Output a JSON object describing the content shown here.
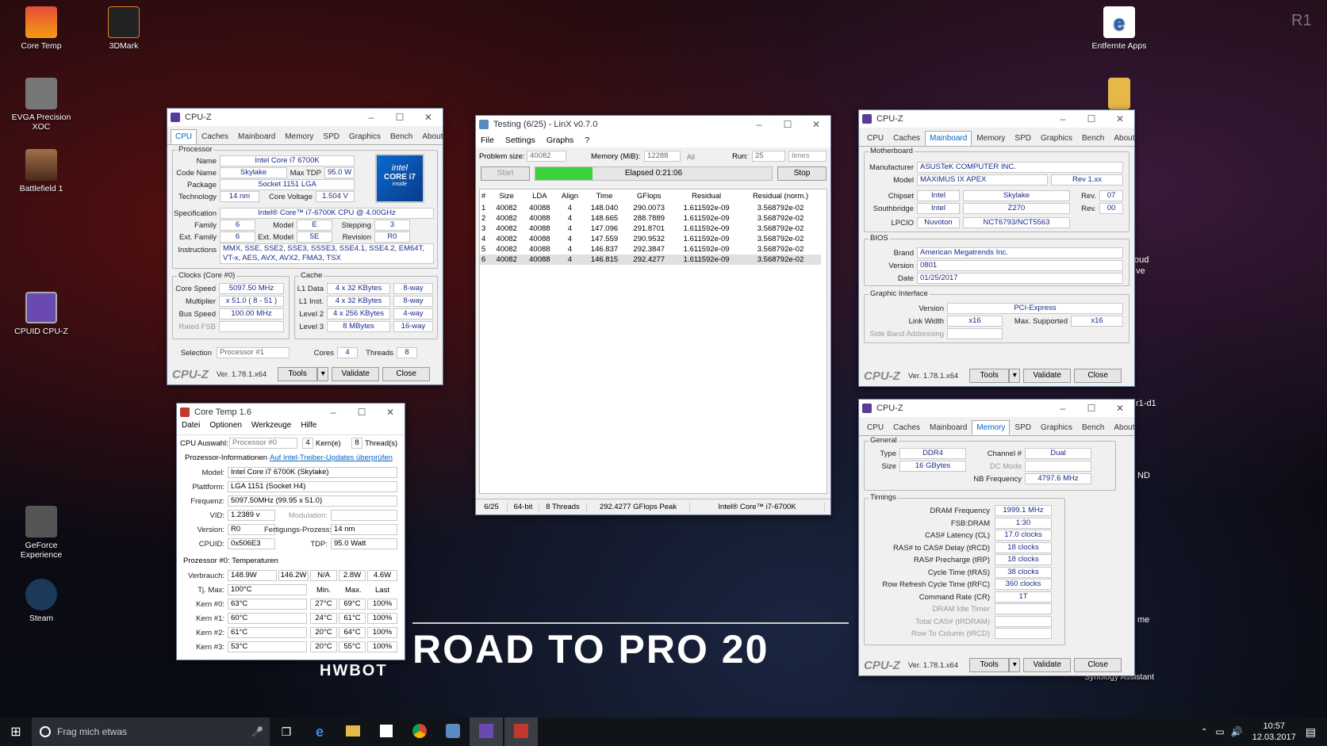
{
  "desktop": {
    "icons": [
      {
        "label": "Core Temp",
        "color": "#c0392b"
      },
      {
        "label": "3DMark",
        "color": "#333"
      },
      {
        "label": "EVGA Precision XOC",
        "color": "#555"
      },
      {
        "label": "Battlefield 1",
        "color": "#8a5a2a"
      },
      {
        "label": "CPUID CPU-Z",
        "color": "#5a3a9a"
      },
      {
        "label": "GeForce Experience",
        "color": "#444"
      },
      {
        "label": "Steam",
        "color": "#1b3a5a"
      },
      {
        "label": "Entfernte Apps",
        "color": "#1a6ac9"
      },
      {
        "label": "Synology Assistant",
        "color": "#3a6aaa"
      }
    ],
    "bg_text": {
      "road": "ROAD TO PRO 20",
      "hwbot": "HWBOT",
      "r1": "R1",
      "oud": "oud",
      "ve": "ve",
      "r1d1": "r1-d1",
      "nd": "ND",
      "me": "me"
    }
  },
  "cpuz_cpu": {
    "title": "CPU-Z",
    "tabs": [
      "CPU",
      "Caches",
      "Mainboard",
      "Memory",
      "SPD",
      "Graphics",
      "Bench",
      "About"
    ],
    "processor_label": "Processor",
    "name_l": "Name",
    "name": "Intel Core i7 6700K",
    "codename_l": "Code Name",
    "codename": "Skylake",
    "maxtdp_l": "Max TDP",
    "maxtdp": "95.0 W",
    "package_l": "Package",
    "package": "Socket 1151 LGA",
    "tech_l": "Technology",
    "tech": "14 nm",
    "corev_l": "Core Voltage",
    "corev": "1.504 V",
    "spec_l": "Specification",
    "spec": "Intel® Core™ i7-6700K CPU @ 4.00GHz",
    "family_l": "Family",
    "family": "6",
    "model_l": "Model",
    "model": "E",
    "stepping_l": "Stepping",
    "stepping": "3",
    "extfam_l": "Ext. Family",
    "extfam": "6",
    "extmodel_l": "Ext. Model",
    "extmodel": "5E",
    "revision_l": "Revision",
    "revision": "R0",
    "instr_l": "Instructions",
    "instr": "MMX, SSE, SSE2, SSE3, SSSE3, SSE4.1, SSE4.2, EM64T, VT-x, AES, AVX, AVX2, FMA3, TSX",
    "clocks_label": "Clocks (Core #0)",
    "corespeed_l": "Core Speed",
    "corespeed": "5097.50 MHz",
    "mult_l": "Multiplier",
    "mult": "x 51.0 ( 8 - 51 )",
    "bus_l": "Bus Speed",
    "bus": "100.00 MHz",
    "fsb_l": "Rated FSB",
    "cache_label": "Cache",
    "l1d_l": "L1 Data",
    "l1d": "4 x 32 KBytes",
    "l1d_w": "8-way",
    "l1i_l": "L1 Inst.",
    "l1i": "4 x 32 KBytes",
    "l1i_w": "8-way",
    "l2_l": "Level 2",
    "l2": "4 x 256 KBytes",
    "l2_w": "4-way",
    "l3_l": "Level 3",
    "l3": "8 MBytes",
    "l3_w": "16-way",
    "sel_l": "Selection",
    "sel": "Processor #1",
    "cores_l": "Cores",
    "cores": "4",
    "threads_l": "Threads",
    "threads": "8",
    "logo_line1": "intel",
    "logo_line2": "CORE i7",
    "logo_line3": "inside",
    "footer": {
      "logo": "CPU-Z",
      "version": "Ver. 1.78.1.x64",
      "tools": "Tools",
      "validate": "Validate",
      "close": "Close"
    }
  },
  "coretemp": {
    "title": "Core Temp 1.6",
    "menu": [
      "Datei",
      "Optionen",
      "Werkzeuge",
      "Hilfe"
    ],
    "cpu_sel_l": "CPU Auswahl:",
    "cpu_sel": "Processor #0",
    "kerne": "4",
    "kerne_l": "Kern(e)",
    "threads": "8",
    "threads_l": "Thread(s)",
    "info_l": "Prozessor-Informationen",
    "info_link": "Auf Intel-Treiber-Updates überprüfen",
    "model_l": "Model:",
    "model": "Intel Core i7 6700K (Skylake)",
    "platform_l": "Plattform:",
    "platform": "LGA 1151 (Socket H4)",
    "freq_l": "Frequenz:",
    "freq": "5097.50MHz (99.95 x 51.0)",
    "vid_l": "VID:",
    "vid": "1.2389 v",
    "mod_l": "Modulation:",
    "ver_l": "Version:",
    "ver": "R0",
    "fp_l": "Fertigungs-Prozess:",
    "fp": "14 nm",
    "cpuid_l": "CPUID:",
    "cpuid": "0x506E3",
    "tdp_l": "TDP:",
    "tdp": "95.0 Watt",
    "temps_title": "Prozessor #0: Temperaturen",
    "power_l": "Verbrauch:",
    "power": [
      "148.9W",
      "146.2W",
      "N/A",
      "2.8W",
      "4.6W"
    ],
    "tj_l": "Tj. Max:",
    "tj": "100°C",
    "hdr": [
      "Min.",
      "Max.",
      "Last"
    ],
    "cores": [
      {
        "n": "Kern #0:",
        "t": "63°C",
        "min": "27°C",
        "max": "69°C",
        "load": "100%"
      },
      {
        "n": "Kern #1:",
        "t": "60°C",
        "min": "24°C",
        "max": "61°C",
        "load": "100%"
      },
      {
        "n": "Kern #2:",
        "t": "61°C",
        "min": "20°C",
        "max": "64°C",
        "load": "100%"
      },
      {
        "n": "Kern #3:",
        "t": "53°C",
        "min": "20°C",
        "max": "55°C",
        "load": "100%"
      }
    ]
  },
  "linx": {
    "title": "Testing (6/25) - LinX v0.7.0",
    "menu": [
      "File",
      "Settings",
      "Graphs",
      "?"
    ],
    "ps_l": "Problem size:",
    "ps": "40082",
    "mem_l": "Memory (MiB):",
    "mem": "12288",
    "all": "All",
    "run_l": "Run:",
    "run": "25",
    "times": "times",
    "start": "Start",
    "elapsed": "Elapsed 0:21:06",
    "progress": 0.24,
    "stop": "Stop",
    "headers": [
      "#",
      "Size",
      "LDA",
      "Align",
      "Time",
      "GFlops",
      "Residual",
      "Residual (norm.)"
    ],
    "rows": [
      [
        "1",
        "40082",
        "40088",
        "4",
        "148.040",
        "290.0073",
        "1.611592e-09",
        "3.568792e-02"
      ],
      [
        "2",
        "40082",
        "40088",
        "4",
        "148.665",
        "288.7889",
        "1.611592e-09",
        "3.568792e-02"
      ],
      [
        "3",
        "40082",
        "40088",
        "4",
        "147.096",
        "291.8701",
        "1.611592e-09",
        "3.568792e-02"
      ],
      [
        "4",
        "40082",
        "40088",
        "4",
        "147.559",
        "290.9532",
        "1.611592e-09",
        "3.568792e-02"
      ],
      [
        "5",
        "40082",
        "40088",
        "4",
        "146.837",
        "292.3847",
        "1.611592e-09",
        "3.568792e-02"
      ],
      [
        "6",
        "40082",
        "40088",
        "4",
        "146.815",
        "292.4277",
        "1.611592e-09",
        "3.568792e-02"
      ]
    ],
    "status": [
      "6/25",
      "64-bit",
      "8 Threads",
      "292.4277 GFlops Peak",
      "Intel® Core™ i7-6700K"
    ]
  },
  "cpuz_mb": {
    "title": "CPU-Z",
    "tabs": [
      "CPU",
      "Caches",
      "Mainboard",
      "Memory",
      "SPD",
      "Graphics",
      "Bench",
      "About"
    ],
    "mb_label": "Motherboard",
    "manuf_l": "Manufacturer",
    "manuf": "ASUSTeK COMPUTER INC.",
    "model_l": "Model",
    "model": "MAXIMUS IX APEX",
    "modelrev": "Rev 1.xx",
    "chipset_l": "Chipset",
    "chipset": "Intel",
    "chipset2": "Skylake",
    "rev_l": "Rev.",
    "chipset_rev": "07",
    "sb_l": "Southbridge",
    "sb": "Intel",
    "sb2": "Z270",
    "sb_rev": "00",
    "lpcio_l": "LPCIO",
    "lpcio": "Nuvoton",
    "lpcio2": "NCT6793/NCT5563",
    "bios_label": "BIOS",
    "brand_l": "Brand",
    "brand": "American Megatrends Inc.",
    "bver_l": "Version",
    "bver": "0801",
    "date_l": "Date",
    "date": "01/25/2017",
    "gi_label": "Graphic Interface",
    "giver_l": "Version",
    "giver": "PCI-Express",
    "lw_l": "Link Width",
    "lw": "x16",
    "ms_l": "Max. Supported",
    "ms": "x16",
    "sba_l": "Side Band Addressing",
    "footer": {
      "logo": "CPU-Z",
      "version": "Ver. 1.78.1.x64",
      "tools": "Tools",
      "validate": "Validate",
      "close": "Close"
    }
  },
  "cpuz_mem": {
    "title": "CPU-Z",
    "tabs": [
      "CPU",
      "Caches",
      "Mainboard",
      "Memory",
      "SPD",
      "Graphics",
      "Bench",
      "About"
    ],
    "gen_label": "General",
    "type_l": "Type",
    "type": "DDR4",
    "ch_l": "Channel #",
    "ch": "Dual",
    "size_l": "Size",
    "size": "16 GBytes",
    "dc_l": "DC Mode",
    "nb_l": "NB Frequency",
    "nb": "4797.6 MHz",
    "tim_label": "Timings",
    "timings": [
      [
        "DRAM Frequency",
        "1999.1 MHz"
      ],
      [
        "FSB:DRAM",
        "1:30"
      ],
      [
        "CAS# Latency (CL)",
        "17.0 clocks"
      ],
      [
        "RAS# to CAS# Delay (tRCD)",
        "18 clocks"
      ],
      [
        "RAS# Precharge (tRP)",
        "18 clocks"
      ],
      [
        "Cycle Time (tRAS)",
        "38 clocks"
      ],
      [
        "Row Refresh Cycle Time (tRFC)",
        "360 clocks"
      ],
      [
        "Command Rate (CR)",
        "1T"
      ],
      [
        "DRAM Idle Timer",
        ""
      ],
      [
        "Total CAS# (tRDRAM)",
        ""
      ],
      [
        "Row To Column (tRCD)",
        ""
      ]
    ],
    "footer": {
      "logo": "CPU-Z",
      "version": "Ver. 1.78.1.x64",
      "tools": "Tools",
      "validate": "Validate",
      "close": "Close"
    }
  },
  "taskbar": {
    "search": "Frag mich etwas",
    "time": "10:57",
    "date": "12.03.2017"
  }
}
